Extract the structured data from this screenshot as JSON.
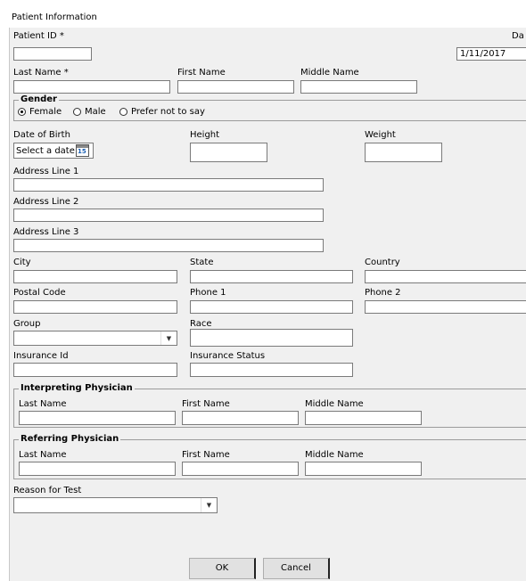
{
  "window": {
    "title": "Patient Information"
  },
  "patient": {
    "patient_id_label": "Patient ID *",
    "date_label_partial": "Da",
    "date_value": "1/11/2017",
    "last_name_label": "Last Name *",
    "first_name_label": "First Name",
    "middle_name_label": "Middle Name"
  },
  "gender": {
    "title": "Gender",
    "options": [
      "Female",
      "Male",
      "Prefer not to say"
    ],
    "selected": "Female"
  },
  "vitals": {
    "dob_label": "Date of Birth",
    "dob_placeholder": "Select a date",
    "calendar_day": "15",
    "height_label": "Height",
    "weight_label": "Weight"
  },
  "address": {
    "line1_label": "Address Line 1",
    "line2_label": "Address Line 2",
    "line3_label": "Address Line 3",
    "city_label": "City",
    "state_label": "State",
    "country_label": "Country",
    "postal_label": "Postal Code",
    "phone1_label": "Phone 1",
    "phone2_label": "Phone 2",
    "group_label": "Group",
    "race_label": "Race",
    "insurance_id_label": "Insurance Id",
    "insurance_status_label": "Insurance Status"
  },
  "interpreting": {
    "title": "Interpreting Physician",
    "last_name_label": "Last Name",
    "first_name_label": "First Name",
    "middle_name_label": "Middle Name"
  },
  "referring": {
    "title": "Referring Physician",
    "last_name_label": "Last Name",
    "first_name_label": "First Name",
    "middle_name_label": "Middle Name"
  },
  "reason": {
    "label": "Reason for Test"
  },
  "buttons": {
    "ok": "OK",
    "cancel": "Cancel"
  }
}
